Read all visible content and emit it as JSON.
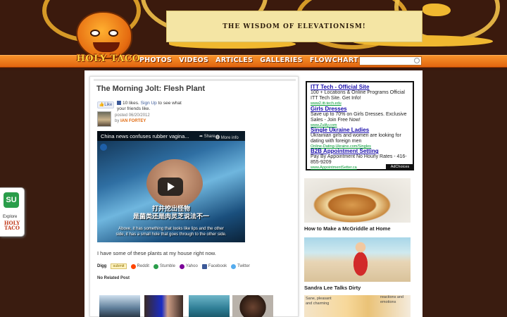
{
  "header": {
    "logo_text": "HOLY TACO",
    "banner_text": "THE WISDOM OF ELEVATIONISM!",
    "nav": [
      "PHOTOS",
      "VIDEOS",
      "ARTICLES",
      "GALLERIES",
      "FLOWCHARTS"
    ],
    "search": {
      "value": "",
      "placeholder": ""
    }
  },
  "post": {
    "title": "The Morning Jolt: Flesh Plant",
    "fb_like_label": "Like",
    "fb_count": "10 likes.",
    "fb_signup": "Sign Up",
    "fb_rest": "to see what your friends like.",
    "posted_prefix": "posted",
    "posted_date": "06/20/2012",
    "by_label": "by",
    "author": "IAN FORTEY",
    "video": {
      "caption": "China news confuses rubber vagina...",
      "share_label": "Share",
      "more_label": "More info",
      "subtitle_cn_1": "打井挖出怪物",
      "subtitle_cn_2": "是菌类还是肉灵芝说法不一",
      "subtitle_en_1": "Above, it has something that looks like lips and the other",
      "subtitle_en_2": "side, it has a small hole that goes through to the other side."
    },
    "body": "I have some of these plants at my house right now.",
    "share": {
      "digg": "Digg",
      "submit": "submit",
      "items": [
        "Reddit",
        "Stumble",
        "Yahoo",
        "Facebook",
        "Twitter"
      ],
      "colors": [
        "#ff4500",
        "#2a9d4a",
        "#7b0099",
        "#3b5998",
        "#55acee"
      ]
    },
    "no_related": "No Related Post"
  },
  "ads": {
    "items": [
      {
        "title": "ITT Tech - Official Site",
        "text": "100 + Locations & Online Programs Official ITT Tech Site. Get Info!",
        "url": "www2.itt-tech.edu"
      },
      {
        "title": "Girls Dresses",
        "text": "Save up to 70% on Girls Dresses. Exclusive Sales - Join Free Now!",
        "url": "www.Zulily.com"
      },
      {
        "title": "Single Ukraine Ladies",
        "text": "Ukrainian girls and women are looking for dating with foreign men",
        "url": "Online-Dating-Ukraine.com/Singles"
      },
      {
        "title": "B2B Appointment Setting",
        "text": "Pay By Appointment No Hourly Rates - 416-855-9209",
        "url": "www.AppointmentSetter.ca"
      }
    ],
    "adchoices": "AdChoices"
  },
  "sidebar": {
    "features": [
      {
        "caption": "How to Make a McGriddle at Home"
      },
      {
        "caption": "Sandra Lee Talks Dirty"
      }
    ],
    "ad_text_left": "Sane, pleasant and charming",
    "ad_text_right": "reactions and emotions"
  },
  "stumble": {
    "badge": "SU",
    "explore": "Explore",
    "brand": "HOLY TACO"
  }
}
